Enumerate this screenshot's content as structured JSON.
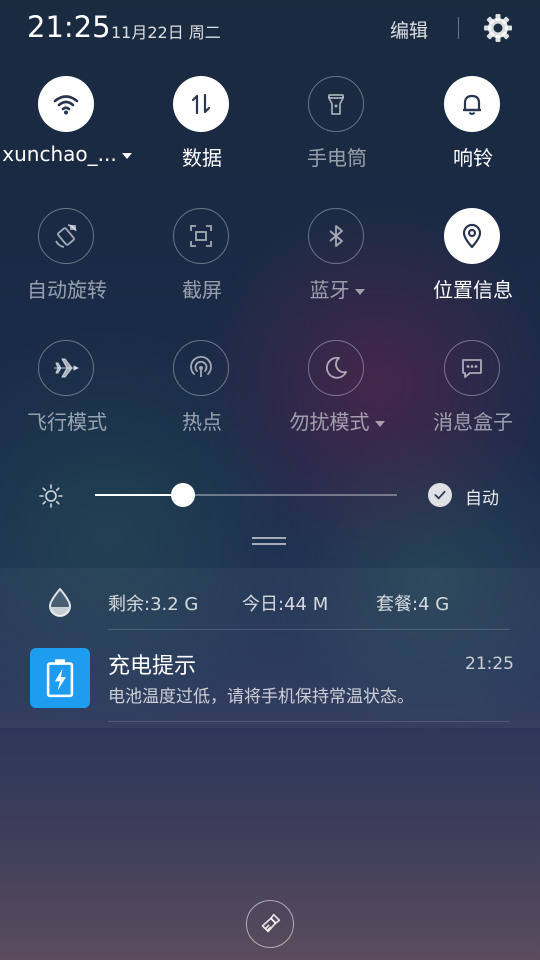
{
  "status": {
    "time": "21:25",
    "date": "11月22日 周二",
    "edit_label": "编辑"
  },
  "tiles": [
    {
      "label": "xunchao_...",
      "icon": "wifi-icon",
      "active": true,
      "dropdown": true
    },
    {
      "label": "数据",
      "icon": "mobile-data-icon",
      "active": true,
      "dropdown": false
    },
    {
      "label": "手电筒",
      "icon": "flashlight-icon",
      "active": false,
      "dropdown": false
    },
    {
      "label": "响铃",
      "icon": "bell-icon",
      "active": true,
      "dropdown": false
    },
    {
      "label": "自动旋转",
      "icon": "auto-rotate-icon",
      "active": false,
      "dropdown": false
    },
    {
      "label": "截屏",
      "icon": "screenshot-icon",
      "active": false,
      "dropdown": false
    },
    {
      "label": "蓝牙",
      "icon": "bluetooth-icon",
      "active": false,
      "dropdown": true
    },
    {
      "label": "位置信息",
      "icon": "location-icon",
      "active": true,
      "dropdown": false
    },
    {
      "label": "飞行模式",
      "icon": "airplane-icon",
      "active": false,
      "dropdown": false
    },
    {
      "label": "热点",
      "icon": "hotspot-icon",
      "active": false,
      "dropdown": false
    },
    {
      "label": "勿扰模式",
      "icon": "do-not-disturb-icon",
      "active": false,
      "dropdown": true
    },
    {
      "label": "消息盒子",
      "icon": "message-box-icon",
      "active": false,
      "dropdown": false
    }
  ],
  "brightness": {
    "level": 0.29,
    "auto_label": "自动",
    "auto_checked": true
  },
  "data_usage": {
    "remaining": "剩余:3.2 G",
    "today": "今日:44 M",
    "plan": "套餐:4 G"
  },
  "notification": {
    "title": "充电提示",
    "body": "电池温度过低，请将手机保持常温状态。",
    "time": "21:25",
    "icon": "battery-charging-icon",
    "icon_color": "#1e9df0"
  },
  "clear_icon": "clear-all-broom-icon"
}
